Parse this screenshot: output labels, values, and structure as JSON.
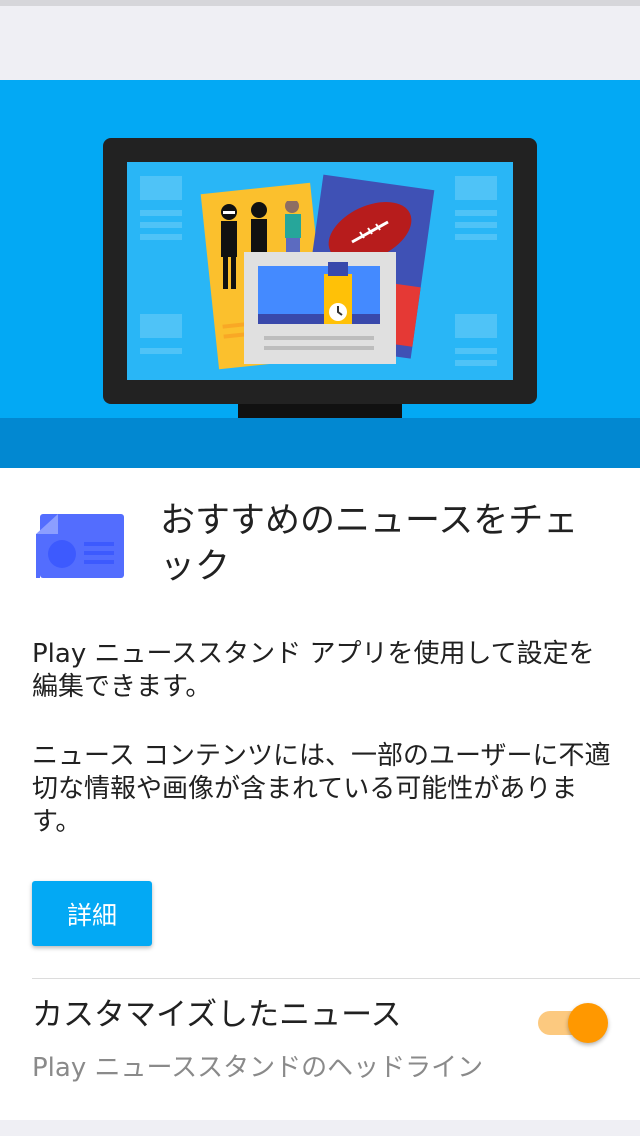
{
  "card": {
    "headline": "おすすめのニュースをチェック",
    "description_1": "Play ニューススタンド アプリを使用して設定を編集できます。",
    "description_2": "ニュース コンテンツには、一部のユーザーに不適切な情報や画像が含まれている可能性があります。",
    "details_button": "詳細",
    "app_icon": "newsstand-icon"
  },
  "setting": {
    "title": "カスタマイズしたニュース",
    "subtitle": "Play ニューススタンドのヘッドライン",
    "toggle_on": true
  },
  "colors": {
    "hero_background": "#03a9f4",
    "accent": "#ff9800",
    "button": "#03a9f4"
  }
}
